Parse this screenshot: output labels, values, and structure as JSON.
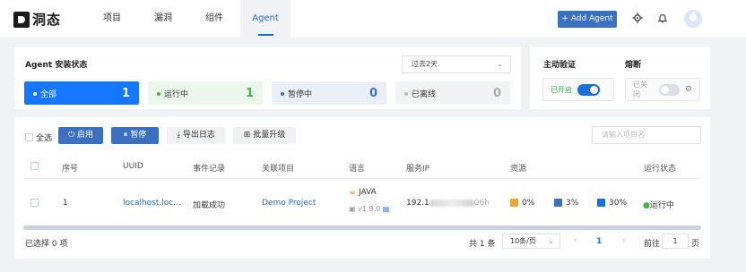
{
  "brand": {
    "name": "洞态"
  },
  "nav": {
    "items": [
      "项目",
      "漏洞",
      "组件",
      "Agent"
    ]
  },
  "header": {
    "add_agent_label": "+ Add Agent",
    "settings_icon": "gear-icon",
    "bell_icon": "bell-icon",
    "avatar_icon": "flame-avatar-icon"
  },
  "status": {
    "title": "Agent 安装状态",
    "range": "过去2天",
    "cards": [
      {
        "label": "全部",
        "count": "1",
        "color": "#1677ff"
      },
      {
        "label": "运行中",
        "count": "1",
        "color": "#3bb54a"
      },
      {
        "label": "暂停中",
        "count": "0",
        "color": "#3b6fbf"
      },
      {
        "label": "已离线",
        "count": "0",
        "color": "#999999"
      }
    ]
  },
  "controls": {
    "verify": {
      "title": "主动验证",
      "state": "已开启",
      "on": true
    },
    "fuse": {
      "title": "熔断",
      "state": "已关闭",
      "on": false
    }
  },
  "toolbar": {
    "select_all": "全选",
    "enable": "启用",
    "pause": "暂停",
    "export_log": "导出日志",
    "batch_upgrade": "批量升级",
    "search_placeholder": "请输入项目名"
  },
  "table": {
    "headers": [
      "序号",
      "UUID",
      "事件记录",
      "关联项目",
      "语言",
      "服务IP",
      "资源",
      "运行状态"
    ],
    "rows": [
      {
        "index": "1",
        "uuid": "localhost.loc...",
        "event": "加载成功",
        "project": "Demo Project",
        "language": "JAVA",
        "version": "v1.9.0",
        "ip_prefix": "192.1",
        "ip_suffix": "06h",
        "cpu": "0%",
        "mem": "3%",
        "disk": "30%",
        "status": "运行中"
      }
    ]
  },
  "footer": {
    "selected": "已选择 0 项",
    "total": "共 1 条",
    "page_size": "10条/页",
    "current_page": "1",
    "goto_label": "前往",
    "goto_value": "1",
    "page_suffix": "页"
  }
}
